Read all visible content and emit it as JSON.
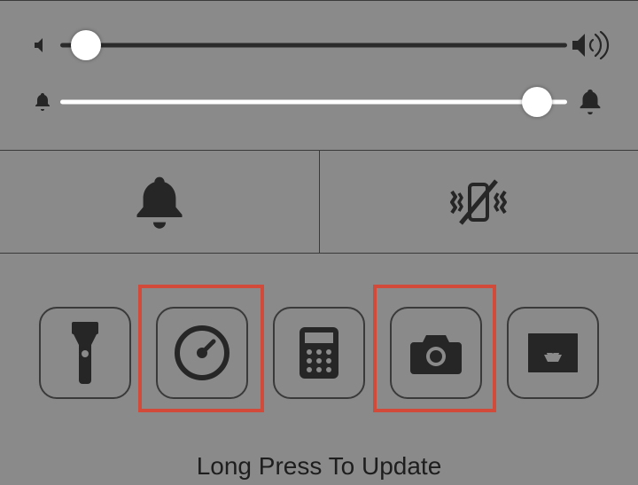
{
  "sliders": {
    "volume": {
      "value": 5,
      "icon_left": "speaker-mute",
      "icon_right": "speaker-loud"
    },
    "ringer": {
      "value": 94,
      "icon_left": "bell-small",
      "icon_right": "bell-solid"
    }
  },
  "modes": {
    "left": {
      "name": "ring-mode",
      "icon": "bell-large"
    },
    "right": {
      "name": "vibrate-off",
      "icon": "vibrate-off"
    }
  },
  "shortcuts": [
    {
      "name": "flashlight",
      "icon": "flashlight",
      "highlighted": false
    },
    {
      "name": "timer",
      "icon": "timer",
      "highlighted": true
    },
    {
      "name": "calculator",
      "icon": "calculator",
      "highlighted": false
    },
    {
      "name": "camera",
      "icon": "camera",
      "highlighted": true
    },
    {
      "name": "downloads",
      "icon": "inbox-down",
      "highlighted": false
    }
  ],
  "footer": {
    "hint": "Long Press To Update"
  },
  "colors": {
    "highlight": "#d24a3a",
    "icon": "#262626"
  }
}
